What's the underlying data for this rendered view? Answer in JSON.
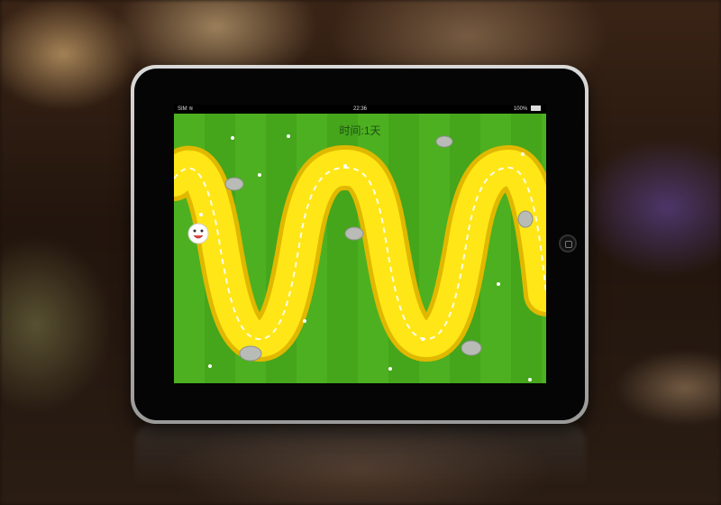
{
  "status_bar": {
    "carrier": "SIM",
    "time": "22:36",
    "battery": "100%"
  },
  "game": {
    "time_label": "时间:1天"
  },
  "icons": {
    "wifi": "wifi-icon",
    "battery": "battery-icon",
    "player": "smiley-face-icon",
    "rock": "rock-icon",
    "flower": "white-flower-icon"
  },
  "colors": {
    "grass": "#4db020",
    "track": "#ffe617",
    "track_edge": "#e1b800",
    "dash": "#ffffff"
  }
}
